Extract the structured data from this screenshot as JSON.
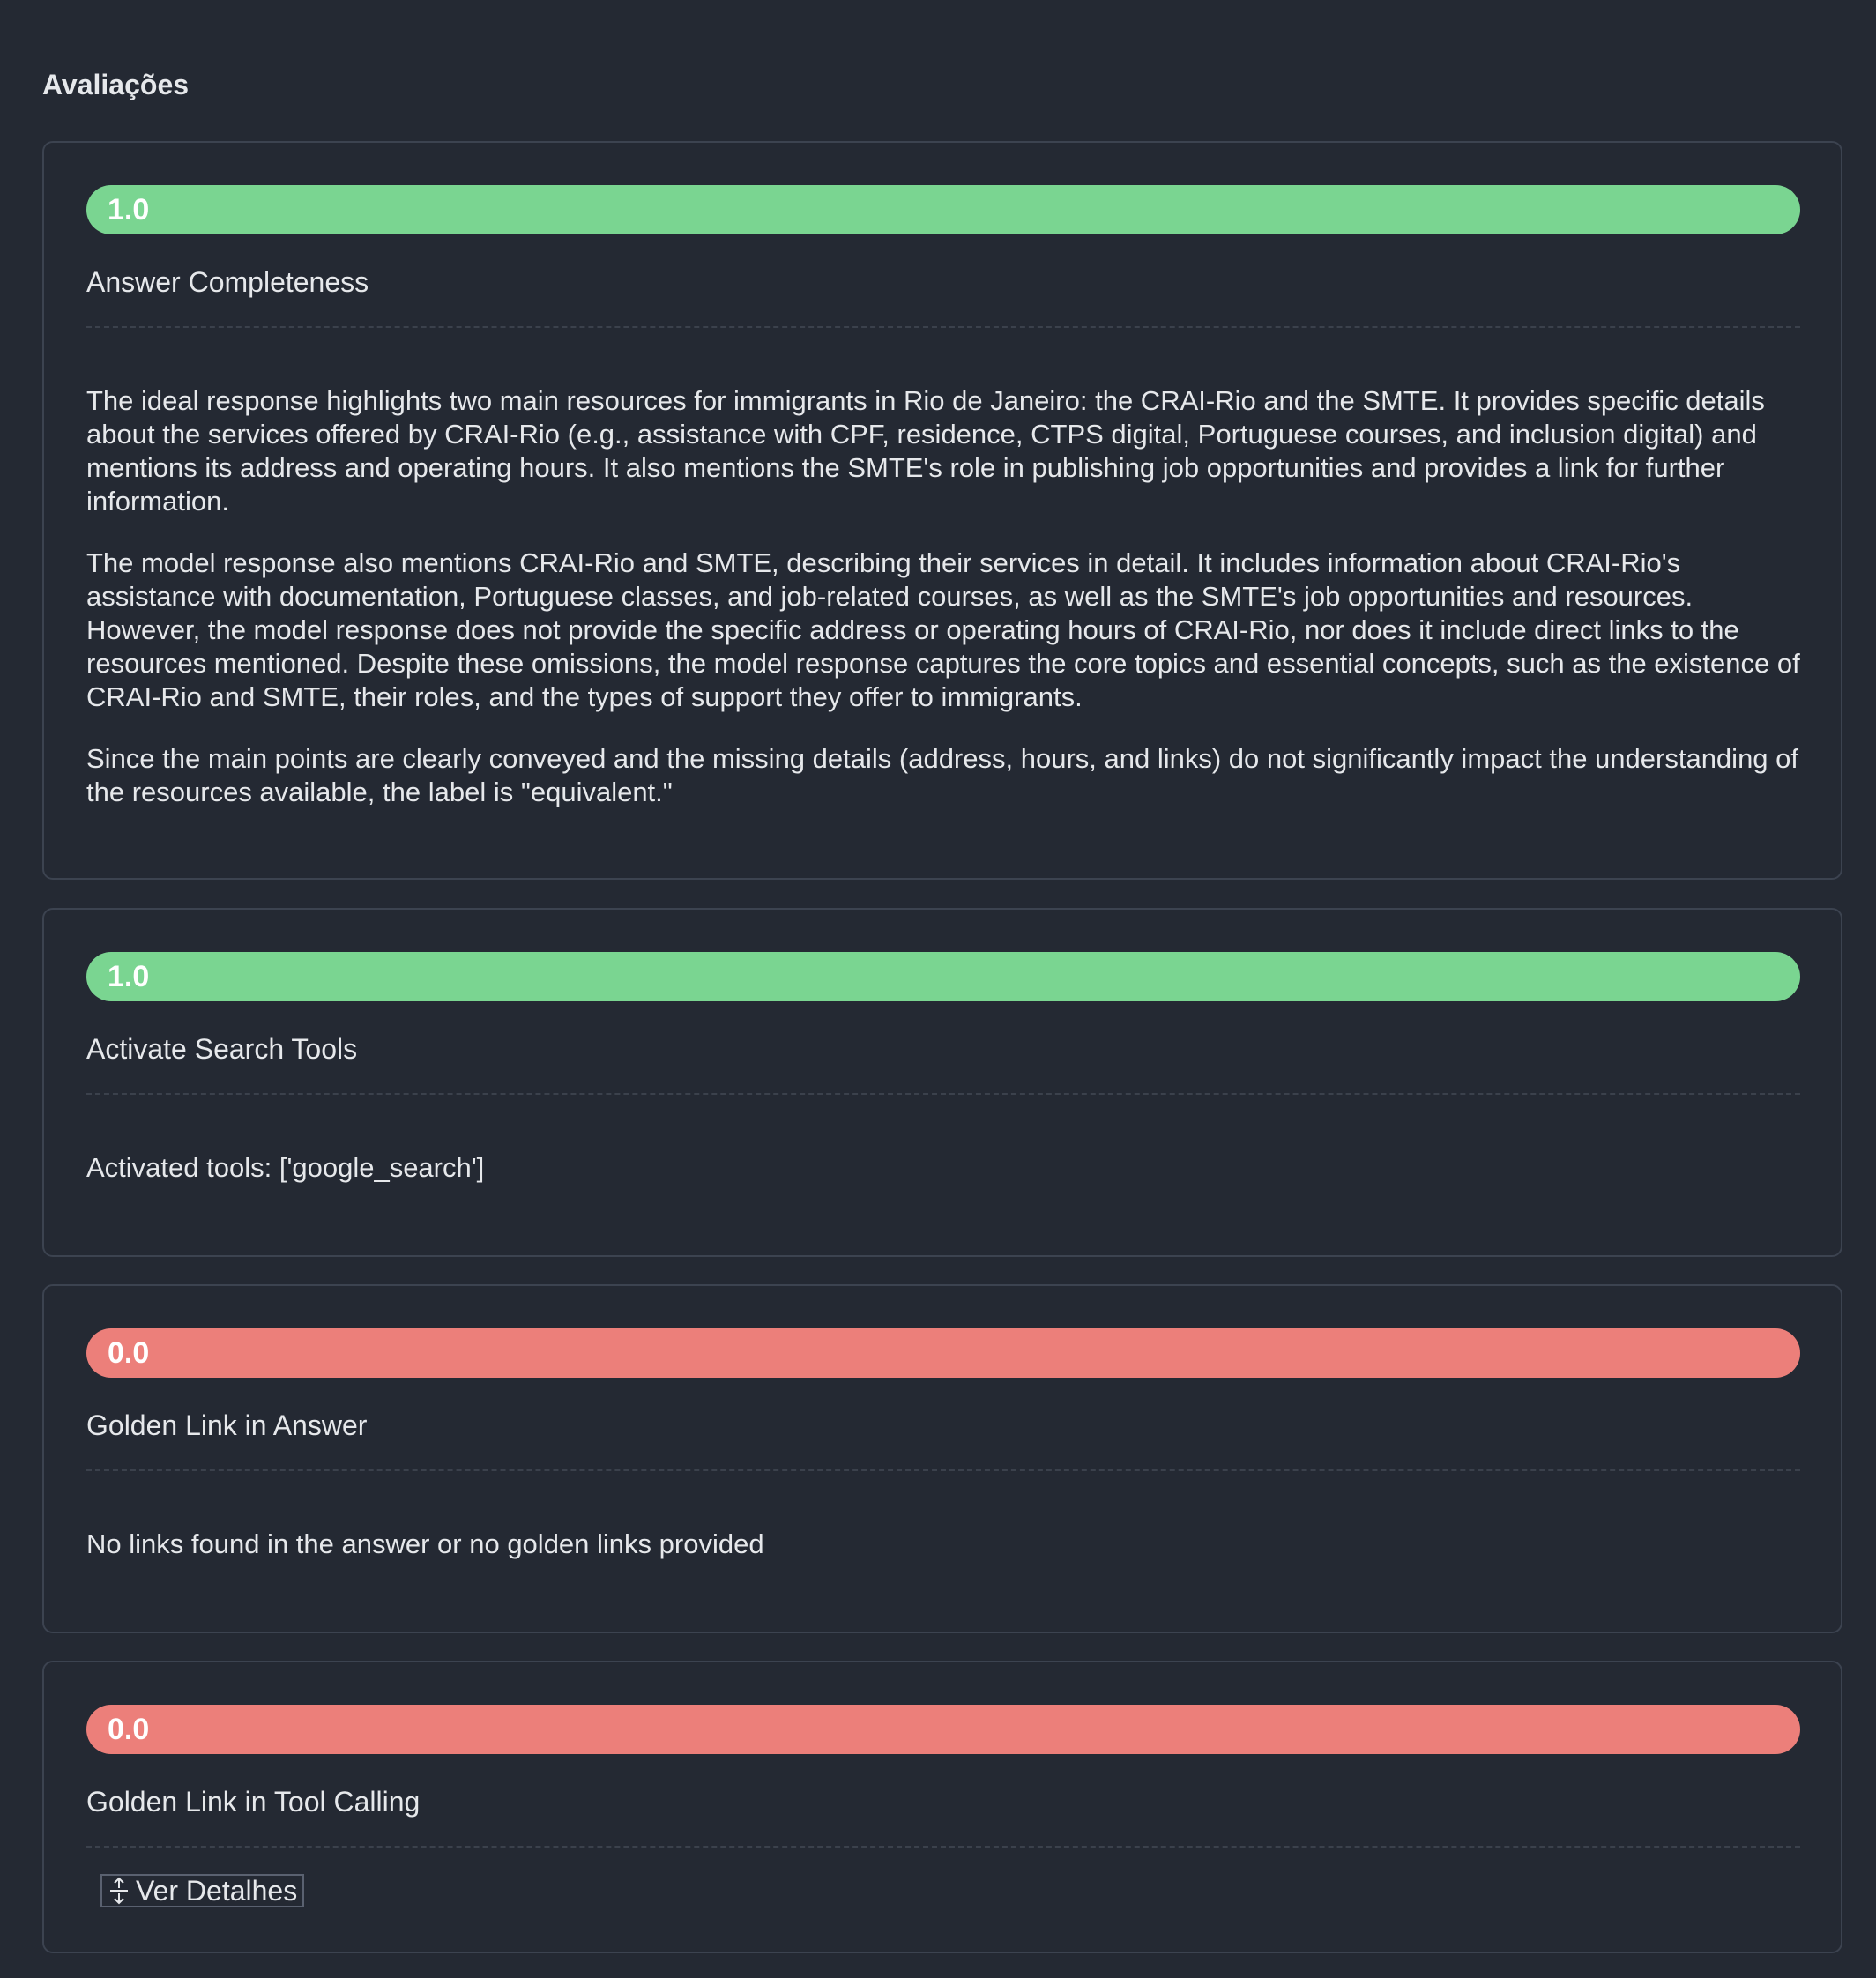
{
  "section": {
    "title": "Avaliações"
  },
  "evaluations": [
    {
      "score": "1.0",
      "status": "pass",
      "name": "Answer Completeness",
      "paragraphs": [
        "The ideal response highlights two main resources for immigrants in Rio de Janeiro: the CRAI-Rio and the SMTE. It provides specific details about the services offered by CRAI-Rio (e.g., assistance with CPF, residence, CTPS digital, Portuguese courses, and inclusion digital) and mentions its address and operating hours. It also mentions the SMTE's role in publishing job opportunities and provides a link for further information.",
        "The model response also mentions CRAI-Rio and SMTE, describing their services in detail. It includes information about CRAI-Rio's assistance with documentation, Portuguese classes, and job-related courses, as well as the SMTE's job opportunities and resources. However, the model response does not provide the specific address or operating hours of CRAI-Rio, nor does it include direct links to the resources mentioned. Despite these omissions, the model response captures the core topics and essential concepts, such as the existence of CRAI-Rio and SMTE, their roles, and the types of support they offer to immigrants.",
        "Since the main points are clearly conveyed and the missing details (address, hours, and links) do not significantly impact the understanding of the resources available, the label is \"equivalent.\""
      ]
    },
    {
      "score": "1.0",
      "status": "pass",
      "name": "Activate Search Tools",
      "paragraphs": [
        "Activated tools: ['google_search']"
      ]
    },
    {
      "score": "0.0",
      "status": "fail",
      "name": "Golden Link in Answer",
      "paragraphs": [
        "No links found in the answer or no golden links provided"
      ]
    },
    {
      "score": "0.0",
      "status": "fail",
      "name": "Golden Link in Tool Calling",
      "details_button_label": "Ver Detalhes"
    }
  ],
  "colors": {
    "background": "#242933",
    "pass": "#7ad591",
    "fail": "#ec7f7a",
    "card_border": "#3c4350",
    "text": "#e6e8eb"
  },
  "icons": {
    "details_button": "expand-vertical-icon"
  }
}
